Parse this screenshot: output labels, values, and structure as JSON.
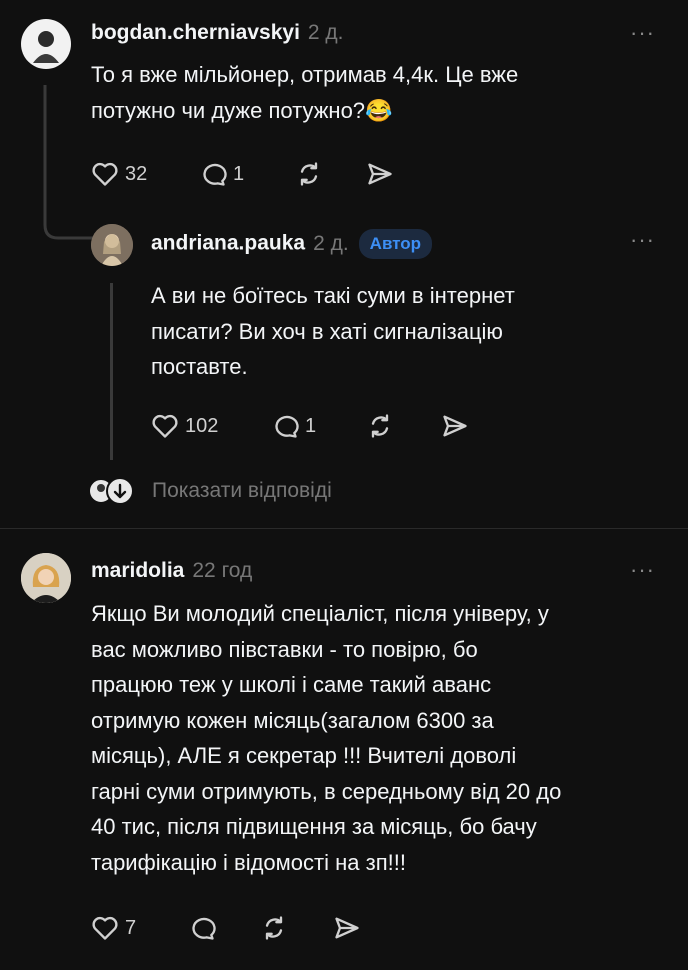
{
  "colors": {
    "background": "#101010",
    "text": "#f3f5f7",
    "muted": "#777777",
    "accent": "#3d8ff5"
  },
  "comments": [
    {
      "username": "bogdan.cherniavskyi",
      "time": "2 д.",
      "text_lines": [
        "То я вже мільйонер, отримав 4,4к. Це вже",
        "потужно чи дуже потужно?😂"
      ],
      "likes": "32",
      "replies": "1"
    },
    {
      "username": "andriana.pauka",
      "time": "2 д.",
      "badge": "Автор",
      "text_lines": [
        "А ви не боїтесь такі суми в інтернет",
        "писати? Ви хоч в хаті сигналізацію",
        "поставте."
      ],
      "likes": "102",
      "replies": "1",
      "show_replies": "Показати відповіді"
    },
    {
      "username": "maridolia",
      "time": "22 год",
      "text_lines": [
        "Якщо Ви молодий спеціаліст, після універу, у",
        "вас можливо півставки - то повірю, бо",
        "працюю теж у школі і саме такий аванс",
        "отримую кожен місяць(загалом 6300 за",
        "місяць), АЛЕ я секретар !!! Вчителі доволі",
        "гарні суми отримують, в середньому від 20 до",
        "40 тис, після підвищення за місяць, бо бачу",
        "тарифікацію і відомості на зп!!!"
      ],
      "likes": "7"
    }
  ],
  "icons": {
    "like": "heart-icon",
    "reply": "comment-icon",
    "repost": "repost-icon",
    "share": "send-icon",
    "more": "more-icon",
    "expand": "arrow-down-icon"
  },
  "more_glyph": "···"
}
